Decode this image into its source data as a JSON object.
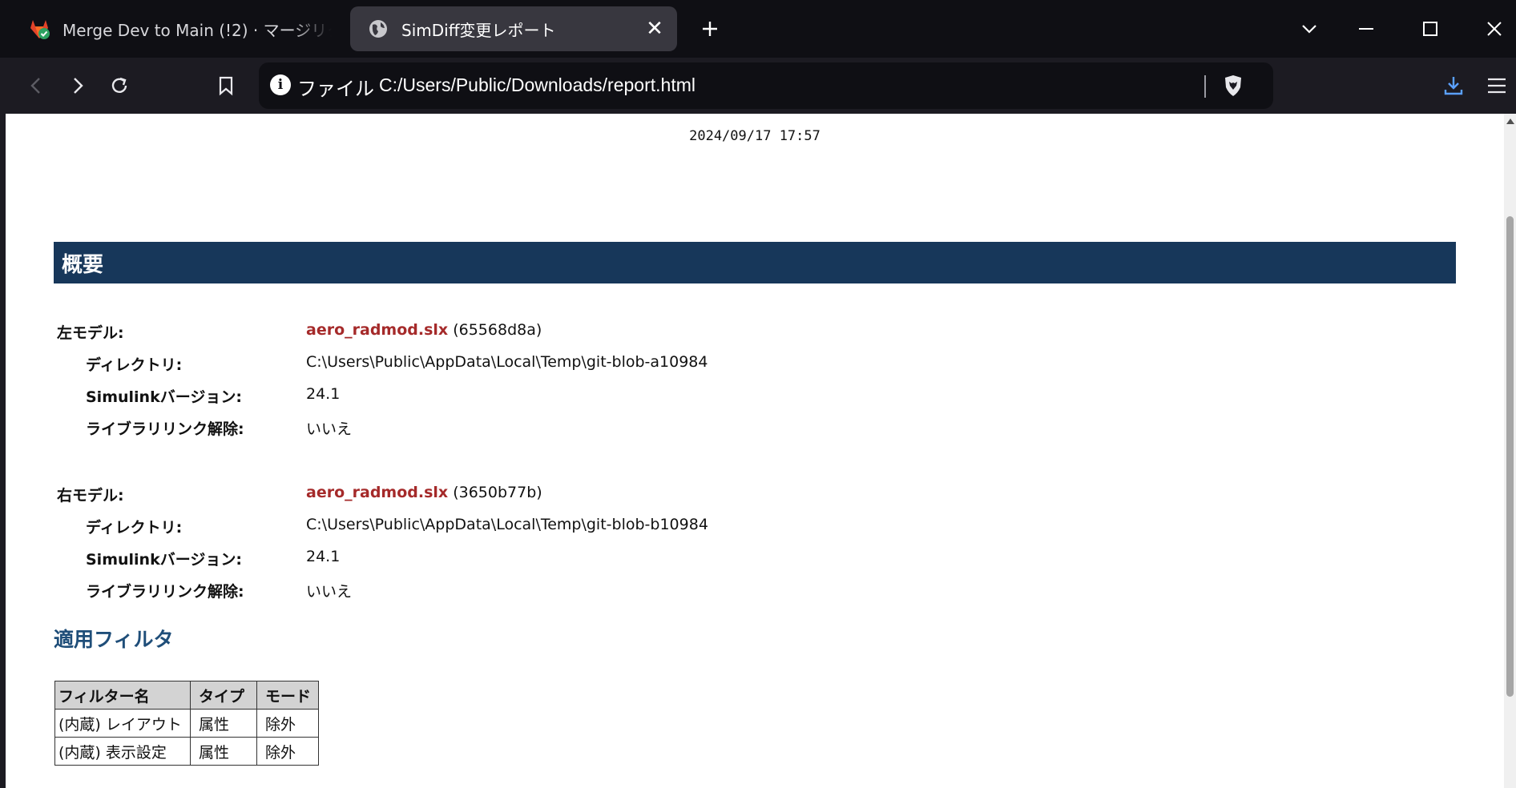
{
  "browser": {
    "tabs": [
      {
        "title": "Merge Dev to Main (!2) · マージリクエスト",
        "favicon": "gitlab-icon",
        "active": false
      },
      {
        "title": "SimDiff変更レポート",
        "favicon": "globe-icon",
        "active": true
      }
    ],
    "address": {
      "scheme_label": "ファイル",
      "url": "C:/Users/Public/Downloads/report.html"
    }
  },
  "report": {
    "date": "2024/09/17 17:57",
    "section_title": "概要",
    "left_model": {
      "label": "左モデル:",
      "file": "aero_radmod.slx",
      "hash": "(65568d8a)",
      "dir_label": "ディレクトリ:",
      "dir": "C:\\Users\\Public\\AppData\\Local\\Temp\\git-blob-a10984",
      "version_label": "Simulinkバージョン:",
      "version": "24.1",
      "libunlink_label": "ライブラリリンク解除:",
      "libunlink": "いいえ"
    },
    "right_model": {
      "label": "右モデル:",
      "file": "aero_radmod.slx",
      "hash": "(3650b77b)",
      "dir_label": "ディレクトリ:",
      "dir": "C:\\Users\\Public\\AppData\\Local\\Temp\\git-blob-b10984",
      "version_label": "Simulinkバージョン:",
      "version": "24.1",
      "libunlink_label": "ライブラリリンク解除:",
      "libunlink": "いいえ"
    },
    "filters_title": "適用フィルタ",
    "filters_table": {
      "headers": [
        "フィルター名",
        "タイプ",
        "モード"
      ],
      "rows": [
        [
          "(内蔵) レイアウト",
          "属性",
          "除外"
        ],
        [
          "(内蔵) 表示設定",
          "属性",
          "除外"
        ]
      ]
    }
  },
  "colors": {
    "section_header_bg": "#17375a",
    "link": "#a52a2a",
    "subhead": "#1f4e79"
  }
}
